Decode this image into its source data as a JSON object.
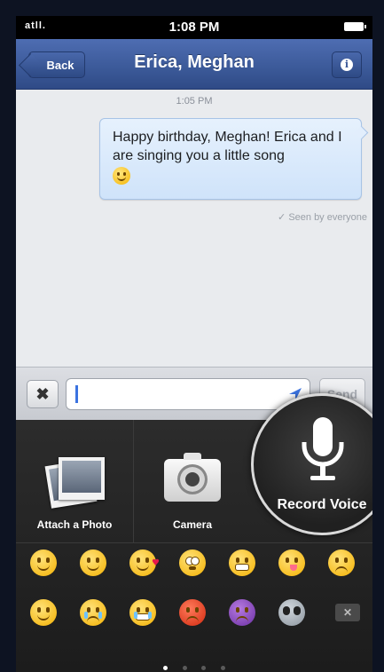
{
  "status_bar": {
    "time": "1:08 PM",
    "signal": "atll."
  },
  "nav": {
    "back_label": "Back",
    "title": "Erica, Meghan",
    "info_icon": "i"
  },
  "conversation": {
    "timestamp": "1:05 PM",
    "message": "Happy birthday, Meghan! Erica and I are singing you a little song",
    "seen": "✓ Seen by everyone"
  },
  "composer": {
    "clear_icon": "✖",
    "send_label": "Send"
  },
  "tray": {
    "attach_label": "Attach a Photo",
    "camera_label": "Camera",
    "record_label": "Record Voice"
  },
  "emoji": {
    "row1": [
      "smile",
      "blush",
      "kiss",
      "wide-eyes",
      "grin",
      "tongue",
      "sad"
    ],
    "row2": [
      "smirk",
      "cry",
      "tears-of-joy",
      "angry",
      "devil",
      "alien",
      "backspace"
    ]
  },
  "pager": {
    "pages": 4,
    "active": 0
  },
  "colors": {
    "nav": "#3b5998",
    "bubble": "#d7e8fb",
    "tray": "#242424"
  }
}
